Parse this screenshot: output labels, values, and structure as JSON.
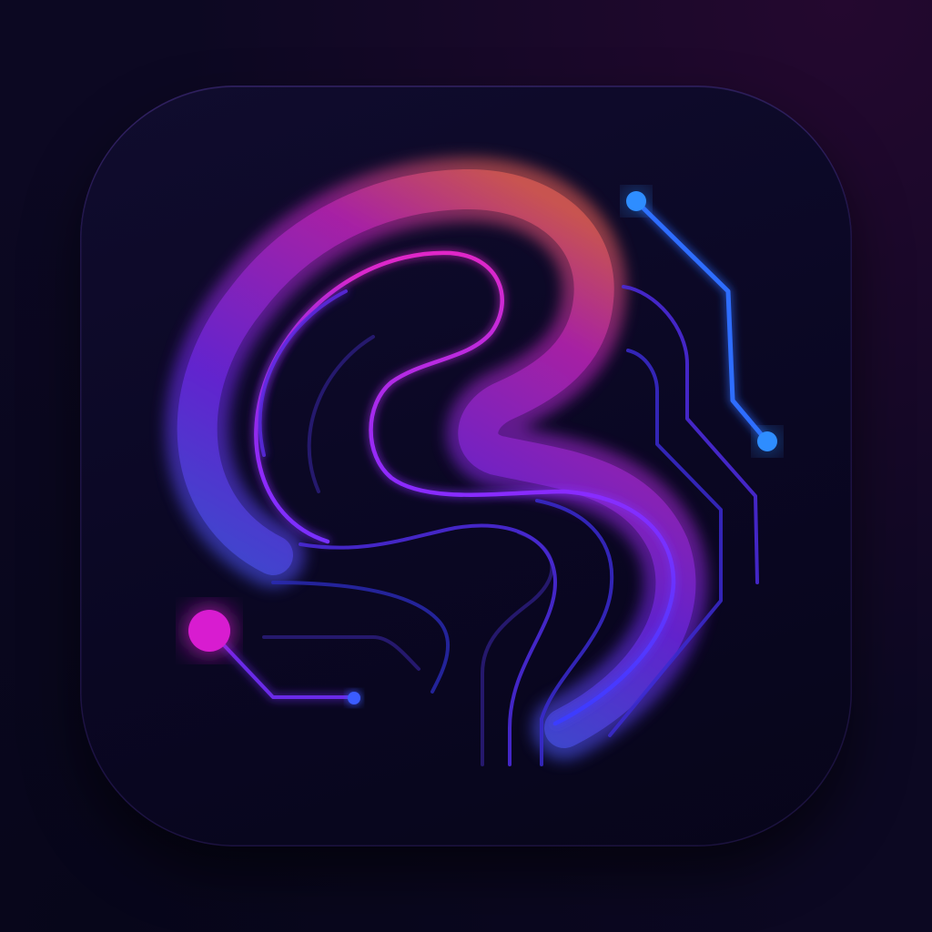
{
  "icon": {
    "name": "neural-path-app-icon",
    "colors": {
      "background": "#0c0822",
      "tile": "#0a0723",
      "magenta": "#e028c8",
      "pink_orange": "#ff5a6a",
      "violet": "#7a2cff",
      "blue": "#2f7bff",
      "cyan_blue": "#2f8dff"
    }
  }
}
